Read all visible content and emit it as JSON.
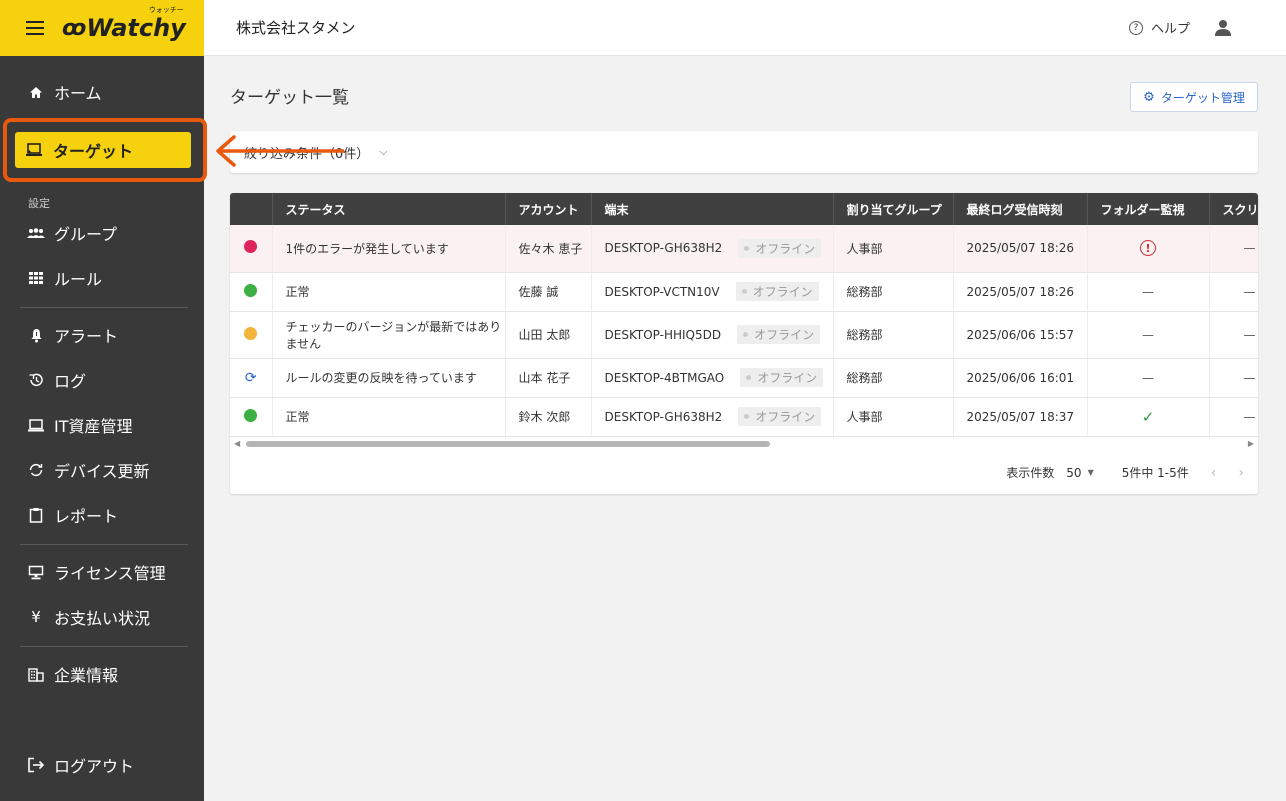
{
  "app": {
    "logo_text": "Watchy",
    "logo_ruby": "ウォッチー"
  },
  "header": {
    "company": "株式会社スタメン",
    "help_label": "ヘルプ"
  },
  "sidebar": {
    "home": "ホーム",
    "target": "ターゲット",
    "section_settings": "設定",
    "group": "グループ",
    "rule": "ルール",
    "alert": "アラート",
    "log": "ログ",
    "it_assets": "IT資産管理",
    "device_update": "デバイス更新",
    "report": "レポート",
    "license": "ライセンス管理",
    "payment": "お支払い状況",
    "company_info": "企業情報",
    "logout": "ログアウト"
  },
  "main": {
    "title": "ターゲット一覧",
    "manage_button": "ターゲット管理",
    "filter_label": "絞り込み条件（0件）"
  },
  "table": {
    "columns": [
      "ステータス",
      "アカウント",
      "端末",
      "割り当てグループ",
      "最終ログ受信時刻",
      "フォルダー監視",
      "スクリーン"
    ],
    "offline_label": "オフライン",
    "rows": [
      {
        "status_icon": "red-dot",
        "status": "1件のエラーが発生しています",
        "account": "佐々木 恵子",
        "device": "DESKTOP-GH638H2",
        "group": "人事部",
        "last_log": "2025/05/07 18:26",
        "folder_watch": "error",
        "screen": "—"
      },
      {
        "status_icon": "green-dot",
        "status": "正常",
        "account": "佐藤 誠",
        "device": "DESKTOP-VCTN10V",
        "group": "総務部",
        "last_log": "2025/05/07 18:26",
        "folder_watch": "—",
        "screen": "—"
      },
      {
        "status_icon": "yellow-dot",
        "status": "チェッカーのバージョンが最新ではありません",
        "account": "山田 太郎",
        "device": "DESKTOP-HHIQ5DD",
        "group": "総務部",
        "last_log": "2025/06/06 15:57",
        "folder_watch": "—",
        "screen": "—"
      },
      {
        "status_icon": "sync-icon",
        "status": "ルールの変更の反映を待っています",
        "account": "山本 花子",
        "device": "DESKTOP-4BTMGAO",
        "group": "総務部",
        "last_log": "2025/06/06 16:01",
        "folder_watch": "—",
        "screen": "—"
      },
      {
        "status_icon": "green-dot",
        "status": "正常",
        "account": "鈴木 次郎",
        "device": "DESKTOP-GH638H2",
        "group": "人事部",
        "last_log": "2025/05/07 18:37",
        "folder_watch": "ok",
        "screen": "—"
      }
    ]
  },
  "pagination": {
    "per_page_label": "表示件数",
    "per_page_value": "50",
    "range": "5件中 1-5件"
  },
  "colors": {
    "brand_yellow": "#f5d20d",
    "sidebar_bg": "#393939",
    "highlight_orange": "#e8590c",
    "accent_blue": "#2a65c9"
  }
}
